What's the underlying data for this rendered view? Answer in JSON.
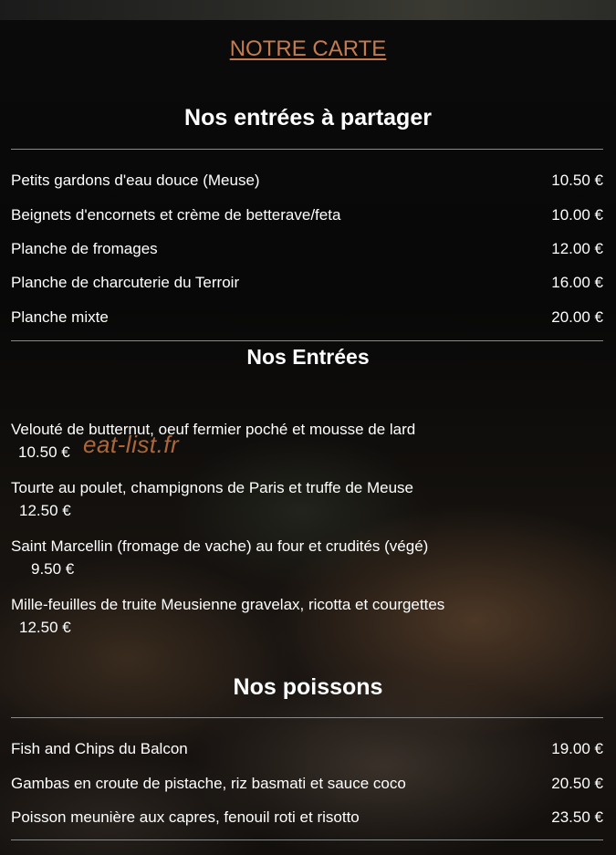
{
  "header": {
    "title": "NOTRE CARTE"
  },
  "sections": [
    {
      "title": "Nos entrées à partager",
      "items": [
        {
          "name": "Petits gardons d'eau douce (Meuse)",
          "price": "10.50 €"
        },
        {
          "name": "Beignets d'encornets et crème de betterave/feta",
          "price": "10.00 €"
        },
        {
          "name": "Planche de fromages",
          "price": "12.00 €"
        },
        {
          "name": "Planche de charcuterie du Terroir",
          "price": "16.00 €"
        },
        {
          "name": "Planche mixte",
          "price": "20.00 €"
        }
      ]
    },
    {
      "title": "Nos Entrées",
      "items": [
        {
          "name": "Velouté de butternut, oeuf fermier poché et mousse de lard",
          "price": "10.50 €"
        },
        {
          "name": "Tourte au poulet, champignons de Paris et truffe de Meuse",
          "price": "12.50 €"
        },
        {
          "name": "Saint Marcellin (fromage de vache) au four et crudités (végé)",
          "price": "9.50 €"
        },
        {
          "name": "Mille-feuilles de truite Meusienne gravelax, ricotta et courgettes",
          "price": "12.50 €"
        }
      ]
    },
    {
      "title": "Nos poissons",
      "items": [
        {
          "name": "Fish and Chips du Balcon",
          "price": "19.00 €"
        },
        {
          "name": "Gambas en croute de pistache, riz basmati et sauce coco",
          "price": "20.50 €"
        },
        {
          "name": "Poisson meunière aux capres, fenouil roti et risotto",
          "price": "23.50 €"
        }
      ]
    }
  ],
  "watermark": "eat-list.fr",
  "colors": {
    "title_accent": "#c47b4f",
    "watermark": "#c9763f",
    "text": "#ffffff",
    "divider": "#8a8a8a"
  }
}
